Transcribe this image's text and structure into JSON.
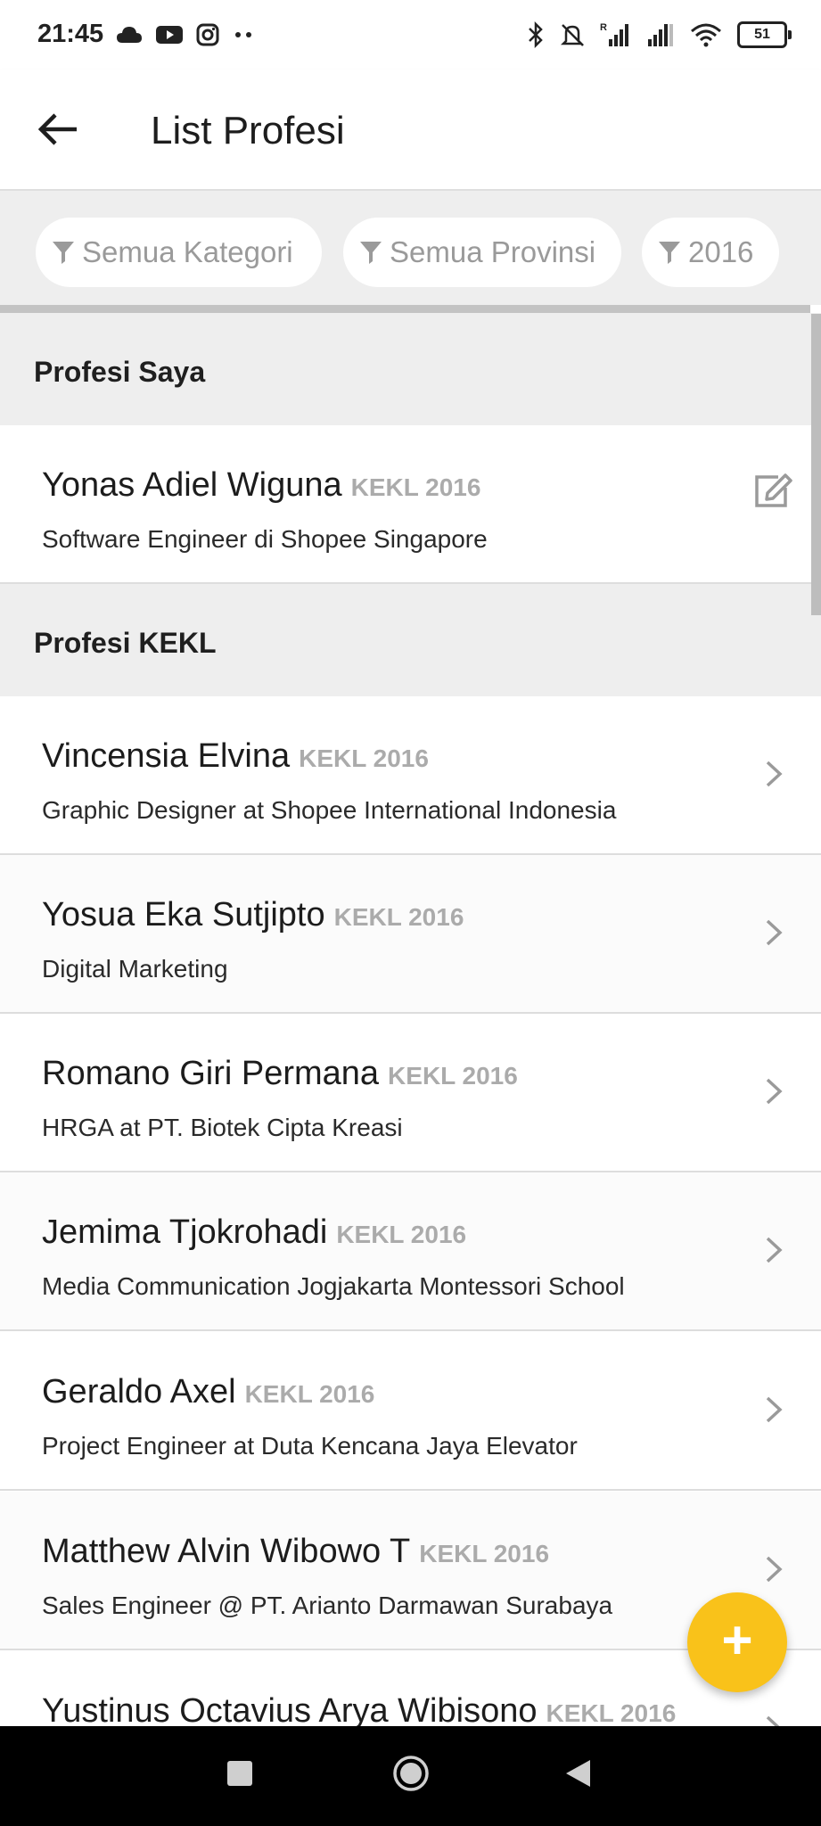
{
  "status_bar": {
    "time": "21:45",
    "left_icons": [
      "cloud-icon",
      "youtube-icon",
      "instagram-icon",
      "more-dots-icon"
    ],
    "right_icons": [
      "bluetooth-icon",
      "alarm-off-icon",
      "signal-roaming-icon",
      "signal-icon",
      "wifi-icon"
    ],
    "battery": "51"
  },
  "app_bar": {
    "title": "List Profesi"
  },
  "filters": [
    {
      "label": "Semua Kategori"
    },
    {
      "label": "Semua Provinsi"
    },
    {
      "label": "2016"
    }
  ],
  "sections": {
    "mine_title": "Profesi Saya",
    "kekl_title": "Profesi KEKL"
  },
  "my_profession": {
    "name": "Yonas Adiel Wiguna",
    "tag": "KEKL 2016",
    "job": "Software Engineer di Shopee Singapore"
  },
  "professions": [
    {
      "name": "Vincensia Elvina",
      "tag": "KEKL 2016",
      "job": "Graphic Designer at Shopee International Indonesia"
    },
    {
      "name": "Yosua Eka Sutjipto",
      "tag": "KEKL 2016",
      "job": "Digital Marketing"
    },
    {
      "name": "Romano Giri Permana",
      "tag": "KEKL 2016",
      "job": "HRGA at PT. Biotek Cipta Kreasi"
    },
    {
      "name": "Jemima Tjokrohadi",
      "tag": "KEKL 2016",
      "job": "Media Communication Jogjakarta Montessori School"
    },
    {
      "name": "Geraldo Axel",
      "tag": "KEKL 2016",
      "job": "Project Engineer at Duta Kencana Jaya Elevator"
    },
    {
      "name": "Matthew Alvin Wibowo T",
      "tag": "KEKL 2016",
      "job": "Sales Engineer @ PT. Arianto Darmawan Surabaya"
    },
    {
      "name": "Yustinus Octavius Arya Wibisono",
      "tag": "KEKL 2016",
      "job": ""
    }
  ],
  "fab": {
    "label": "+"
  },
  "colors": {
    "accent": "#f9c21a",
    "section_bg": "#eeeeee",
    "tag_text": "#ababab",
    "nav_bar": "#000000"
  }
}
